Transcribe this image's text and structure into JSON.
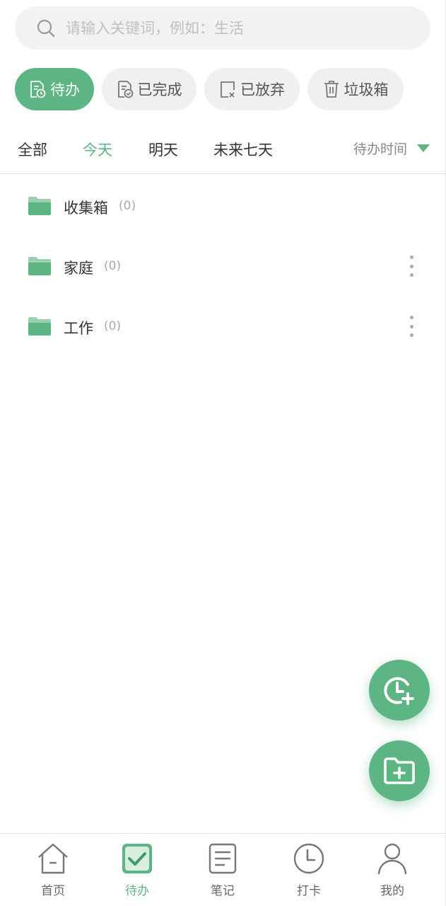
{
  "search": {
    "placeholder": "请输入关键词，例如：生活"
  },
  "status_chips": [
    {
      "label": "待办",
      "icon": "todo-doc-clock-icon",
      "active": true
    },
    {
      "label": "已完成",
      "icon": "doc-check-icon",
      "active": false
    },
    {
      "label": "已放弃",
      "icon": "doc-x-icon",
      "active": false
    },
    {
      "label": "垃圾箱",
      "icon": "trash-icon",
      "active": false
    }
  ],
  "date_tabs": [
    {
      "label": "全部",
      "active": false
    },
    {
      "label": "今天",
      "active": true
    },
    {
      "label": "明天",
      "active": false
    },
    {
      "label": "未来七天",
      "active": false
    }
  ],
  "sort": {
    "label": "待办时间",
    "icon": "triangle-down-icon"
  },
  "folders": [
    {
      "name": "收集箱",
      "count": "(0)",
      "has_more": false
    },
    {
      "name": "家庭",
      "count": "(0)",
      "has_more": true
    },
    {
      "name": "工作",
      "count": "(0)",
      "has_more": true
    }
  ],
  "fabs": [
    {
      "icon": "clock-plus-icon"
    },
    {
      "icon": "folder-plus-icon"
    }
  ],
  "bottom_nav": [
    {
      "label": "首页",
      "icon": "home-icon",
      "active": false
    },
    {
      "label": "待办",
      "icon": "checkbox-icon",
      "active": true
    },
    {
      "label": "笔记",
      "icon": "note-icon",
      "active": false
    },
    {
      "label": "打卡",
      "icon": "clock-icon",
      "active": false
    },
    {
      "label": "我的",
      "icon": "user-icon",
      "active": false
    }
  ],
  "colors": {
    "accent": "#5cb583",
    "chip_bg": "#f0f0f0",
    "search_bg": "#f2f2f2",
    "muted_text": "#aaaaaa"
  }
}
